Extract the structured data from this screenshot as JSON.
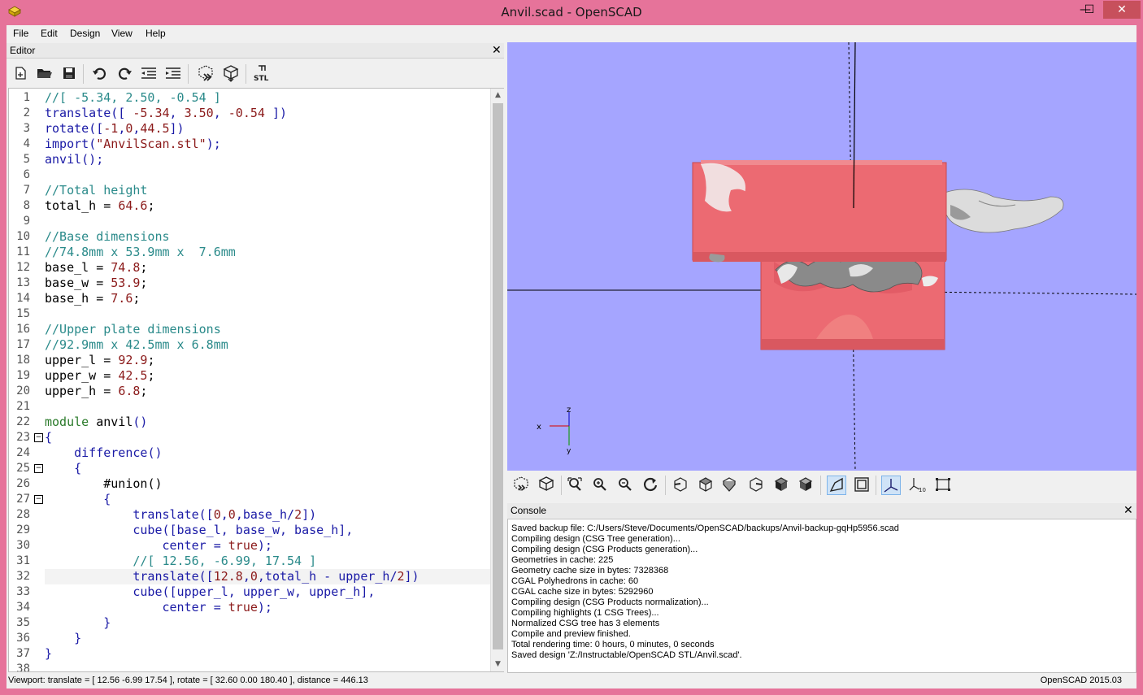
{
  "window": {
    "title": "Anvil.scad - OpenSCAD",
    "min_glyph": "—",
    "max_glyph": "☐",
    "close_glyph": "✕"
  },
  "menu": [
    "File",
    "Edit",
    "Design",
    "View",
    "Help"
  ],
  "editor": {
    "title": "Editor",
    "close_glyph": "✕",
    "toolbar_icons": [
      "new-file-icon",
      "open-file-icon",
      "save-icon",
      "undo-icon",
      "redo-icon",
      "unindent-icon",
      "indent-icon",
      "preview-icon",
      "render-icon",
      "export-stl-icon"
    ],
    "lines": [
      {
        "n": "1",
        "tokens": [
          {
            "t": "//[ -5.34, 2.50, -0.54 ]",
            "c": "comment"
          }
        ]
      },
      {
        "n": "2",
        "tokens": [
          {
            "t": "translate",
            "c": "func"
          },
          {
            "t": "([ ",
            "c": "func"
          },
          {
            "t": "-5.34",
            "c": "num"
          },
          {
            "t": ", ",
            "c": "func"
          },
          {
            "t": "3.50",
            "c": "num"
          },
          {
            "t": ", ",
            "c": "func"
          },
          {
            "t": "-0.54",
            "c": "num"
          },
          {
            "t": " ])",
            "c": "func"
          }
        ]
      },
      {
        "n": "3",
        "tokens": [
          {
            "t": "rotate",
            "c": "func"
          },
          {
            "t": "([",
            "c": "func"
          },
          {
            "t": "-1",
            "c": "num"
          },
          {
            "t": ",",
            "c": "func"
          },
          {
            "t": "0",
            "c": "num"
          },
          {
            "t": ",",
            "c": "func"
          },
          {
            "t": "44.5",
            "c": "num"
          },
          {
            "t": "])",
            "c": "func"
          }
        ]
      },
      {
        "n": "4",
        "tokens": [
          {
            "t": "import",
            "c": "func"
          },
          {
            "t": "(",
            "c": "func"
          },
          {
            "t": "\"AnvilScan.stl\"",
            "c": "str"
          },
          {
            "t": ");",
            "c": "func"
          }
        ]
      },
      {
        "n": "5",
        "tokens": [
          {
            "t": "anvil",
            "c": "func"
          },
          {
            "t": "();",
            "c": "func"
          }
        ]
      },
      {
        "n": "6",
        "tokens": []
      },
      {
        "n": "7",
        "tokens": [
          {
            "t": "//Total height",
            "c": "comment"
          }
        ]
      },
      {
        "n": "8",
        "tokens": [
          {
            "t": "total_h = ",
            "c": "plain"
          },
          {
            "t": "64.6",
            "c": "num"
          },
          {
            "t": ";",
            "c": "plain"
          }
        ]
      },
      {
        "n": "9",
        "tokens": []
      },
      {
        "n": "10",
        "tokens": [
          {
            "t": "//Base dimensions",
            "c": "comment"
          }
        ]
      },
      {
        "n": "11",
        "tokens": [
          {
            "t": "//74.8mm x 53.9mm x  7.6mm",
            "c": "comment"
          }
        ]
      },
      {
        "n": "12",
        "tokens": [
          {
            "t": "base_l = ",
            "c": "plain"
          },
          {
            "t": "74.8",
            "c": "num"
          },
          {
            "t": ";",
            "c": "plain"
          }
        ]
      },
      {
        "n": "13",
        "tokens": [
          {
            "t": "base_w = ",
            "c": "plain"
          },
          {
            "t": "53.9",
            "c": "num"
          },
          {
            "t": ";",
            "c": "plain"
          }
        ]
      },
      {
        "n": "14",
        "tokens": [
          {
            "t": "base_h = ",
            "c": "plain"
          },
          {
            "t": "7.6",
            "c": "num"
          },
          {
            "t": ";",
            "c": "plain"
          }
        ]
      },
      {
        "n": "15",
        "tokens": []
      },
      {
        "n": "16",
        "tokens": [
          {
            "t": "//Upper plate dimensions",
            "c": "comment"
          }
        ]
      },
      {
        "n": "17",
        "tokens": [
          {
            "t": "//92.9mm x 42.5mm x 6.8mm",
            "c": "comment"
          }
        ]
      },
      {
        "n": "18",
        "tokens": [
          {
            "t": "upper_l = ",
            "c": "plain"
          },
          {
            "t": "92.9",
            "c": "num"
          },
          {
            "t": ";",
            "c": "plain"
          }
        ]
      },
      {
        "n": "19",
        "tokens": [
          {
            "t": "upper_w = ",
            "c": "plain"
          },
          {
            "t": "42.5",
            "c": "num"
          },
          {
            "t": ";",
            "c": "plain"
          }
        ]
      },
      {
        "n": "20",
        "tokens": [
          {
            "t": "upper_h = ",
            "c": "plain"
          },
          {
            "t": "6.8",
            "c": "num"
          },
          {
            "t": ";",
            "c": "plain"
          }
        ]
      },
      {
        "n": "21",
        "tokens": []
      },
      {
        "n": "22",
        "tokens": [
          {
            "t": "module",
            "c": "kw"
          },
          {
            "t": " anvil",
            "c": "plain"
          },
          {
            "t": "()",
            "c": "func"
          }
        ]
      },
      {
        "n": "23",
        "tokens": [
          {
            "t": "{",
            "c": "func"
          }
        ],
        "fold": true
      },
      {
        "n": "24",
        "tokens": [
          {
            "t": "    difference",
            "c": "func"
          },
          {
            "t": "()",
            "c": "func"
          }
        ]
      },
      {
        "n": "25",
        "tokens": [
          {
            "t": "    {",
            "c": "func"
          }
        ],
        "fold": true
      },
      {
        "n": "26",
        "tokens": [
          {
            "t": "        #union",
            "c": "plain"
          },
          {
            "t": "()",
            "c": "plain"
          }
        ]
      },
      {
        "n": "27",
        "tokens": [
          {
            "t": "        {",
            "c": "func"
          }
        ],
        "fold": true
      },
      {
        "n": "28",
        "tokens": [
          {
            "t": "            translate",
            "c": "func"
          },
          {
            "t": "([",
            "c": "func"
          },
          {
            "t": "0",
            "c": "num"
          },
          {
            "t": ",",
            "c": "func"
          },
          {
            "t": "0",
            "c": "num"
          },
          {
            "t": ",",
            "c": "func"
          },
          {
            "t": "base_h/",
            "c": "func"
          },
          {
            "t": "2",
            "c": "num"
          },
          {
            "t": "])",
            "c": "func"
          }
        ]
      },
      {
        "n": "29",
        "tokens": [
          {
            "t": "            cube",
            "c": "func"
          },
          {
            "t": "([base_l, base_w, base_h],",
            "c": "func"
          }
        ]
      },
      {
        "n": "30",
        "tokens": [
          {
            "t": "                center = ",
            "c": "func"
          },
          {
            "t": "true",
            "c": "bool"
          },
          {
            "t": ");",
            "c": "func"
          }
        ]
      },
      {
        "n": "31",
        "tokens": [
          {
            "t": "            //[ 12.56, -6.99, 17.54 ]",
            "c": "comment"
          }
        ]
      },
      {
        "n": "32",
        "tokens": [
          {
            "t": "            translate",
            "c": "func"
          },
          {
            "t": "([",
            "c": "func"
          },
          {
            "t": "12.8",
            "c": "num"
          },
          {
            "t": ",",
            "c": "func"
          },
          {
            "t": "0",
            "c": "num"
          },
          {
            "t": ",total_h - upper_h/",
            "c": "func"
          },
          {
            "t": "2",
            "c": "num"
          },
          {
            "t": "])",
            "c": "func"
          }
        ],
        "highlight": true
      },
      {
        "n": "33",
        "tokens": [
          {
            "t": "            cube",
            "c": "func"
          },
          {
            "t": "([upper_l, upper_w, upper_h],",
            "c": "func"
          }
        ]
      },
      {
        "n": "34",
        "tokens": [
          {
            "t": "                center = ",
            "c": "func"
          },
          {
            "t": "true",
            "c": "bool"
          },
          {
            "t": ");",
            "c": "func"
          }
        ]
      },
      {
        "n": "35",
        "tokens": [
          {
            "t": "        }",
            "c": "func"
          }
        ]
      },
      {
        "n": "36",
        "tokens": [
          {
            "t": "    }",
            "c": "func"
          }
        ]
      },
      {
        "n": "37",
        "tokens": [
          {
            "t": "}",
            "c": "func"
          }
        ]
      },
      {
        "n": "38",
        "tokens": []
      }
    ]
  },
  "viewport": {
    "background": "#a5a5ff",
    "model_color": "#ec6a72",
    "axes_labels": {
      "z": "z",
      "x": "x",
      "y": "y"
    }
  },
  "view_toolbar_icons": [
    "preview-icon",
    "render-icon",
    "view-all-icon",
    "zoom-in-icon",
    "zoom-out-icon",
    "reset-view-icon",
    "view-right-icon",
    "view-top-icon",
    "view-bottom-icon",
    "view-left-icon",
    "view-front-icon",
    "view-back-icon",
    "perspective-icon",
    "orthogonal-icon",
    "show-axes-icon",
    "show-scale-icon",
    "show-edges-icon"
  ],
  "console": {
    "title": "Console",
    "close_glyph": "✕",
    "lines": [
      "Saved backup file: C:/Users/Steve/Documents/OpenSCAD/backups/Anvil-backup-gqHp5956.scad",
      "Compiling design (CSG Tree generation)...",
      "Compiling design (CSG Products generation)...",
      "Geometries in cache: 225",
      "Geometry cache size in bytes: 7328368",
      "CGAL Polyhedrons in cache: 60",
      "CGAL cache size in bytes: 5292960",
      "Compiling design (CSG Products normalization)...",
      "Compiling highlights (1 CSG Trees)...",
      "Normalized CSG tree has 3 elements",
      "Compile and preview finished.",
      "Total rendering time: 0 hours, 0 minutes, 0 seconds",
      "Saved design 'Z:/Instructable/OpenSCAD STL/Anvil.scad'."
    ]
  },
  "status": {
    "viewport": "Viewport: translate = [ 12.56 -6.99 17.54 ], rotate = [ 32.60 0.00 180.40 ], distance = 446.13",
    "version": "OpenSCAD 2015.03"
  }
}
